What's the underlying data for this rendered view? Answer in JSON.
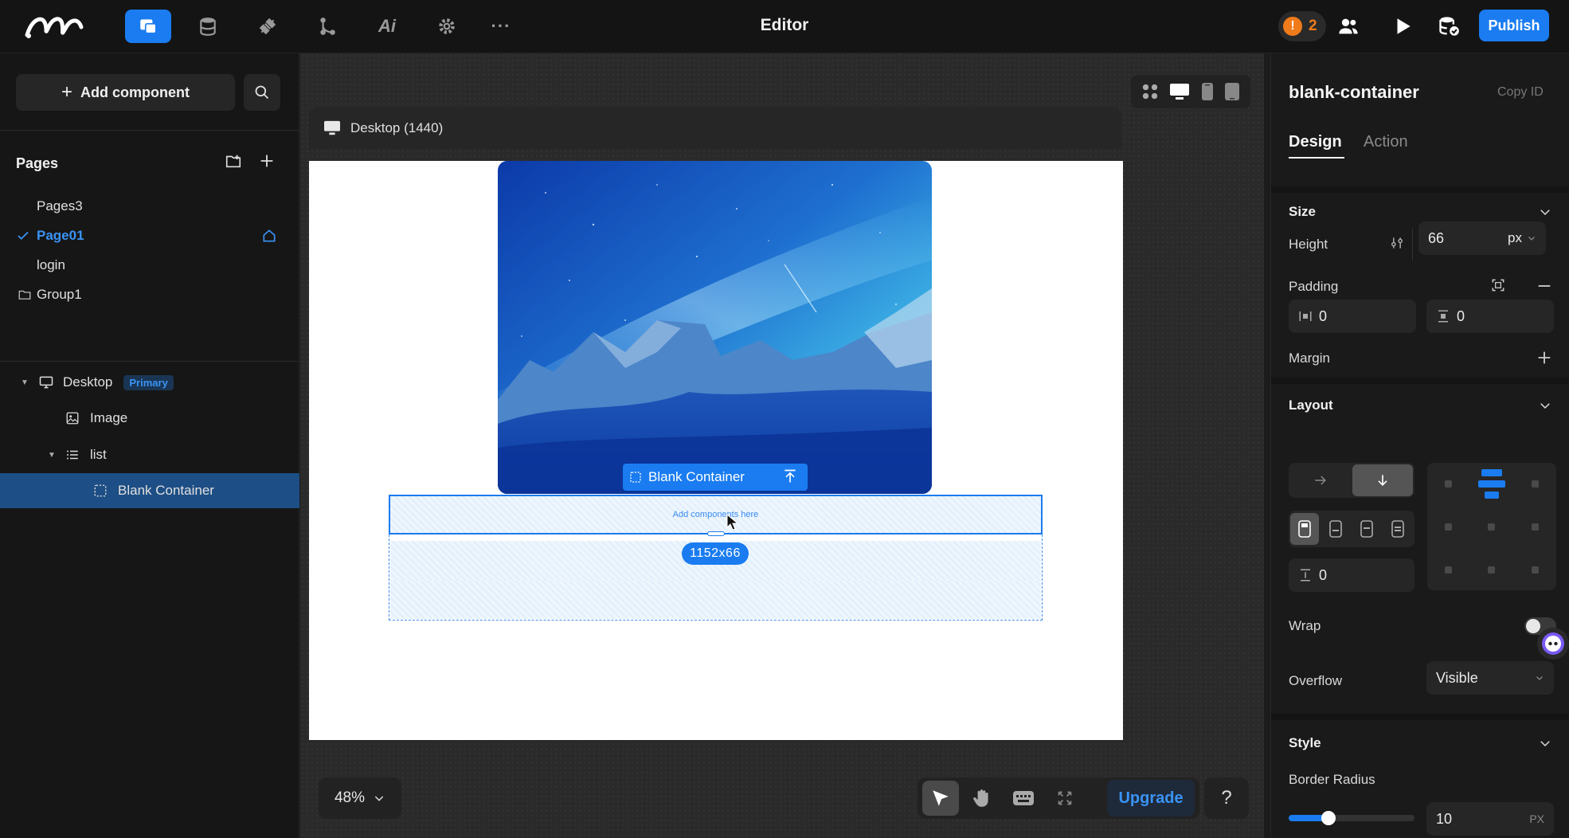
{
  "app": {
    "title": "Editor",
    "warning_count": "2",
    "warn_symbol": "!",
    "publish_label": "Publish"
  },
  "nav_icons": [
    "pages-icon",
    "database-icon",
    "plugin-icon",
    "flow-icon",
    "ai-icon",
    "settings-icon",
    "more-icon"
  ],
  "nav_ai_label": "Ai",
  "nav_more_label": "···",
  "sidebar": {
    "add_component_label": "Add component",
    "pages_heading": "Pages",
    "pages": [
      {
        "label": "Pages3"
      },
      {
        "label": "Page01",
        "current": true
      },
      {
        "label": "login"
      },
      {
        "label": "Group1"
      }
    ],
    "layers": [
      {
        "label": "Desktop",
        "badge": "Primary"
      },
      {
        "label": "Image"
      },
      {
        "label": "list"
      },
      {
        "label": "Blank Container",
        "selected": true
      }
    ]
  },
  "canvas": {
    "frame_label": "Desktop (1440)",
    "selected_tag": "Blank Container",
    "placeholder": "Add components here",
    "dimensions": "1152x66",
    "zoom": "48%",
    "upgrade_label": "Upgrade",
    "help_label": "?"
  },
  "inspector": {
    "component_name": "blank-container",
    "copy_id_label": "Copy ID",
    "tabs": [
      "Design",
      "Action"
    ],
    "size_heading": "Size",
    "height_label": "Height",
    "height_value": "66",
    "height_unit": "px",
    "padding_label": "Padding",
    "padding_x": "0",
    "padding_y": "0",
    "margin_label": "Margin",
    "layout_heading": "Layout",
    "gap_value": "0",
    "wrap_label": "Wrap",
    "overflow_label": "Overflow",
    "overflow_value": "Visible",
    "style_heading": "Style",
    "border_radius_label": "Border Radius",
    "border_radius_value": "10",
    "border_radius_unit": "PX"
  },
  "colors": {
    "accent": "#1a7cf0",
    "warning": "#f07b1a"
  }
}
